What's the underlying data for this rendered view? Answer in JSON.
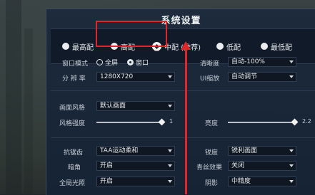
{
  "dialog": {
    "title": "系统设置"
  },
  "presets": [
    {
      "label": "最高配",
      "selected": false
    },
    {
      "label": "高配",
      "selected": false
    },
    {
      "label": "中配 (推荐)",
      "selected": true
    },
    {
      "label": "低配",
      "selected": false
    },
    {
      "label": "最低配",
      "selected": false
    }
  ],
  "display": {
    "window_mode_label": "窗口模式",
    "fullscreen_label": "全屏",
    "windowed_label": "窗口",
    "window_mode_selected": "窗口",
    "resolution_label": "分 辨 率",
    "resolution_value": "1280X720",
    "clarity_label": "清晰度",
    "clarity_value": "自动-100%",
    "ui_scale_label": "UI缩放",
    "ui_scale_value": "自动调节"
  },
  "style": {
    "style_label": "画面风格",
    "style_value": "默认画面",
    "strength_label": "风格强度",
    "strength_value": "1",
    "brightness_label": "亮度",
    "brightness_value": "2.2"
  },
  "quality": {
    "aa_label": "抗锯齿",
    "aa_value": "TAA运动柔和",
    "sharpen_label": "锐度",
    "sharpen_value": "锐利画面",
    "dark_label": "暗角",
    "dark_value": "开启",
    "tint_label": "青丝效果",
    "tint_value": "关闭",
    "gi_label": "全局光照",
    "gi_value": "开启",
    "shadow_label": "阴影",
    "shadow_value": "中精度"
  },
  "annotation": {
    "color": "#e0262a"
  }
}
